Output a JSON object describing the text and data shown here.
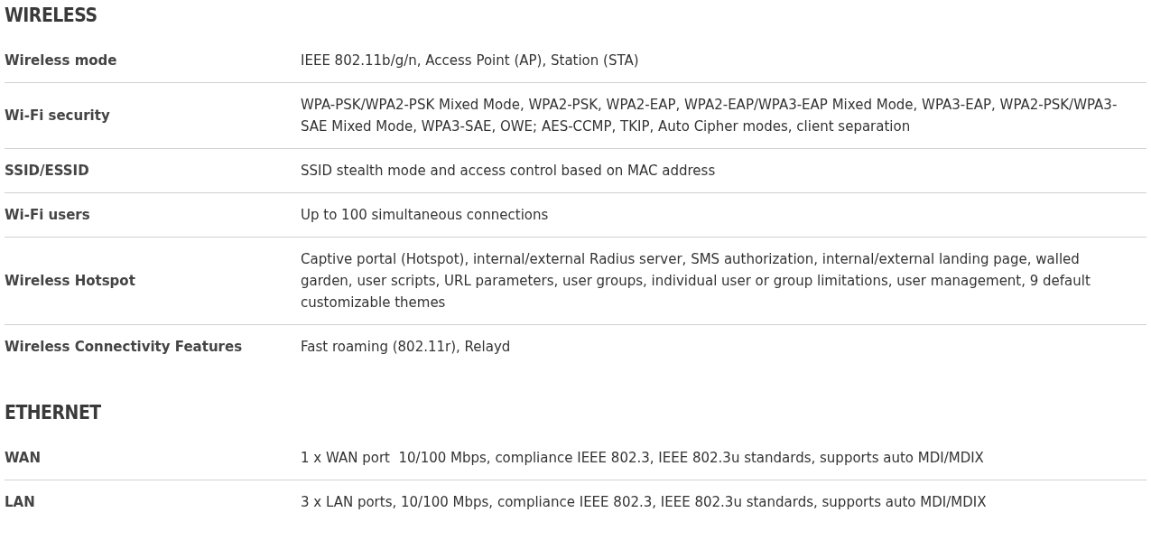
{
  "sections": [
    {
      "title": "WIRELESS",
      "rows": [
        {
          "label": "Wireless mode",
          "value": "IEEE 802.11b/g/n, Access Point (AP), Station (STA)"
        },
        {
          "label": "Wi-Fi security",
          "value": "WPA-PSK/WPA2-PSK Mixed Mode, WPA2-PSK, WPA2-EAP, WPA2-EAP/WPA3-EAP Mixed Mode, WPA3-EAP, WPA2-PSK/WPA3-SAE Mixed Mode, WPA3-SAE, OWE; AES-CCMP, TKIP, Auto Cipher modes, client separation"
        },
        {
          "label": "SSID/ESSID",
          "value": "SSID stealth mode and access control based on MAC address"
        },
        {
          "label": "Wi-Fi users",
          "value": "Up to 100 simultaneous connections"
        },
        {
          "label": "Wireless Hotspot",
          "value": "Captive portal (Hotspot), internal/external Radius server, SMS authorization, internal/external landing page, walled garden, user scripts, URL parameters, user groups, individual user or group limitations, user management, 9 default customizable themes"
        },
        {
          "label": "Wireless Connectivity Features",
          "value": "Fast roaming (802.11r), Relayd"
        }
      ]
    },
    {
      "title": "ETHERNET",
      "rows": [
        {
          "label": "WAN",
          "value": "1 x WAN port  10/100 Mbps, compliance IEEE 802.3, IEEE 802.3u standards, supports auto MDI/MDIX"
        },
        {
          "label": "LAN",
          "value": "3 x LAN ports, 10/100 Mbps, compliance IEEE 802.3, IEEE 802.3u standards, supports auto MDI/MDIX"
        }
      ]
    }
  ]
}
